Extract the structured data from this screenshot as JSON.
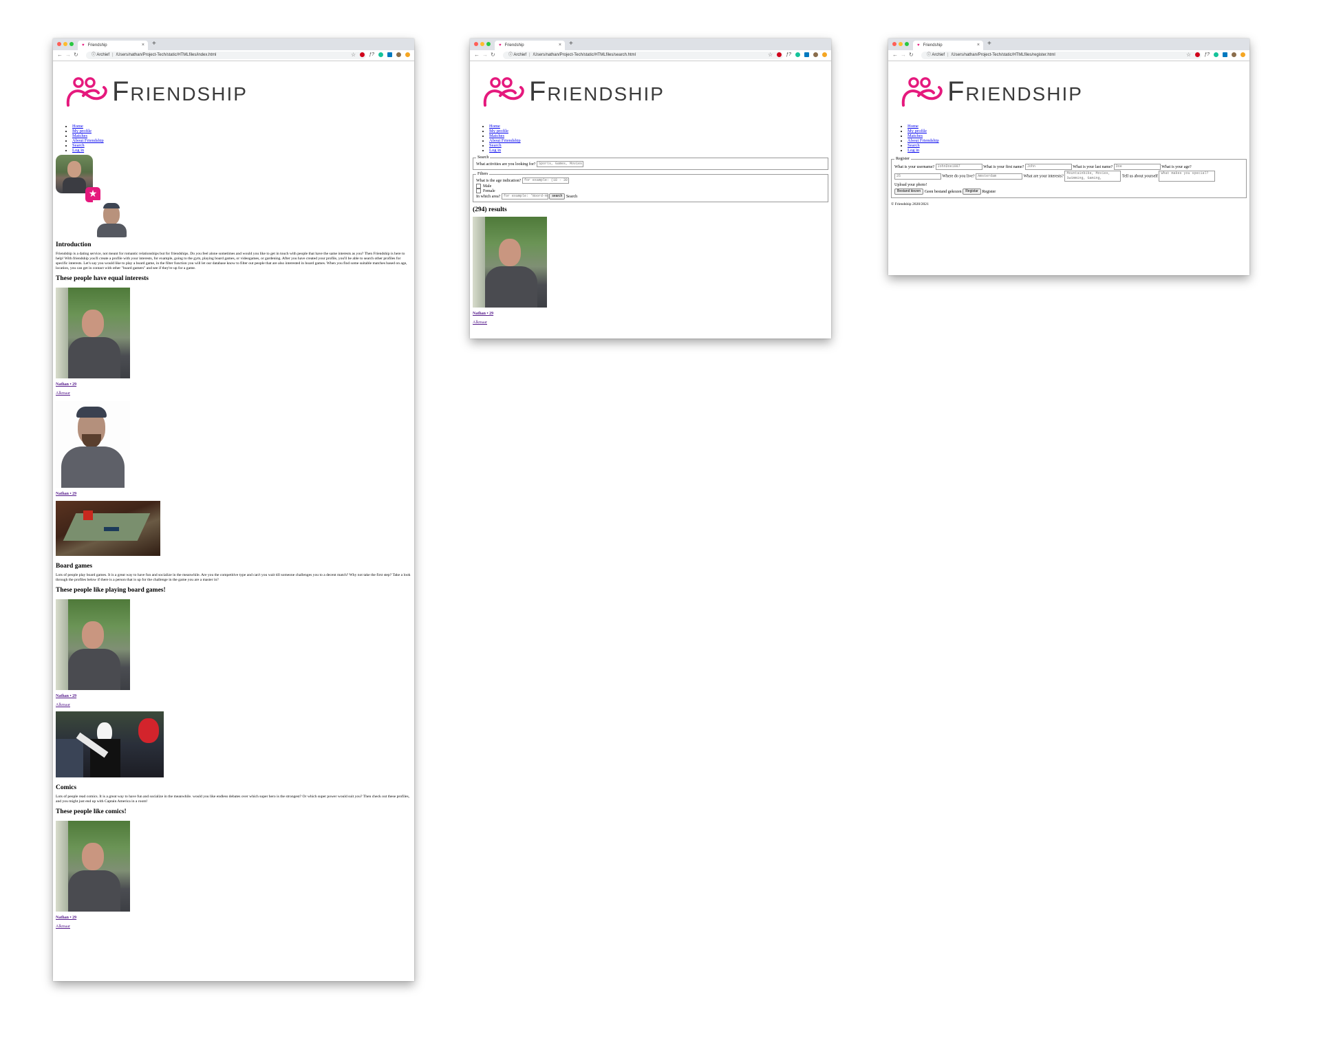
{
  "browser": {
    "tab_title": "Friendship",
    "new_tab": "+",
    "close": "×",
    "address_prefix": "Archief",
    "urls": {
      "index": "/Users/nathan/Project-Tech/static/HTMLfiles/index.html",
      "search": "/Users/nathan/Project-Tech/static/HTMLfiles/search.html",
      "register": "/Users/nathan/Project-Tech/static/HTMLfiles/register.html"
    },
    "colors": {
      "close": "#ff5f57",
      "minimize": "#febc2e",
      "maximize": "#28c840",
      "brand": "#e5197d"
    }
  },
  "site": {
    "logo_text": "Friendship",
    "nav": [
      "Home",
      "My profile",
      "Matches",
      "About Friendship",
      "Search",
      "Log in"
    ]
  },
  "index": {
    "intro_heading": "Introduction",
    "intro_text": "Friendship is a dating service, not meant for romantic relationships but for friendships. Do you feel alone sometimes and would you like to get in touch with people that have the same interests as you? Then Friendship is here to help! With friendship you'll create a profile with your interests, for example, going to the gym, playing board games, or videogames, or gardening. After you have created your profile, you'll be able to search other profiles for specific interests. Let's say you would like to play a board game, in the filter function you will let our database know to filter out people that are also interested in board games. When you find some suitable matches based on age, location, you can get in contact with other \"board gamers\" and see if they're up for a game.",
    "equal_heading": "These people have equal interests",
    "card1": {
      "name": "Nathan • 29",
      "city": "Alkmaar"
    },
    "card2": {
      "name": "Nathan • 29"
    },
    "board_heading": "Board games",
    "board_text": "Lots of people play board games. It is a great way to have fun and socialize in the meanwhile. Are you the competitive type and can't you wait till someone challenges you to a decent match? Why not take the first step? Take a look through the profiles below if there is a person that is up for the challenge in the game you are a master in?",
    "board_people_heading": "These people like playing board games!",
    "card3": {
      "name": "Nathan • 29",
      "city": "Alkmaar"
    },
    "comics_heading": "Comics",
    "comics_text": "Lots of people read comics. It is a great way to have fun and socialize in the meanwhile. would you like endless debates over which super hero is the strongest? Or which super power would suit you? Then check out these profiles, and you might just end up with Captain America in a room!",
    "comics_people_heading": "These people like comics!",
    "card4": {
      "name": "Nathan • 29",
      "city": "Alkmaar"
    }
  },
  "search": {
    "legend": "Search",
    "activities_label": "What activities are you looking for?",
    "activities_placeholder": "Sports, Games, Movies",
    "filters_legend": "Filters",
    "age_label": "What is the age indication?",
    "age_placeholder": "for example: (18 - 30 yrs)",
    "male": "Male",
    "female": "Female",
    "area_label": "In which area?",
    "area_placeholder": "for example: 'Noord-Holl",
    "search_button": "search",
    "search_text": "Search",
    "results": "(294) results",
    "card": {
      "name": "Nathan • 29",
      "city": "Alkmaar"
    }
  },
  "register": {
    "legend": "Register",
    "username_label": "What is your username?",
    "username_placeholder": "JohnDoe1987",
    "firstname_label": "What is your first name?",
    "firstname_placeholder": "John",
    "lastname_label": "What is your last name?",
    "lastname_placeholder": "Doe",
    "age_label": "What is your age?",
    "age_placeholder": "25",
    "love_label": "Where do you live?",
    "love_placeholder": "Amsterdam",
    "interests_label": "What are your interests?",
    "interests_placeholder": "Mountainbike, Movies, Swimming, Gaming,",
    "about_label": "Tell us about yourself",
    "about_placeholder": "What makes you special?",
    "upload_label": "Upload your photo!",
    "choose_button": "Bestand kiezen",
    "no_file": "Geen bestand gekozen",
    "register_button": "Registar",
    "register_text": "Register",
    "footer": "© Friendship 2020/2021"
  }
}
